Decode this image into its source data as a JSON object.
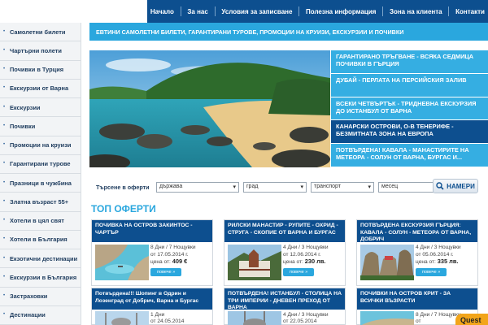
{
  "top_nav": {
    "items": [
      {
        "label": "Начало"
      },
      {
        "label": "За нас"
      },
      {
        "label": "Условия за записване"
      },
      {
        "label": "Полезна информация"
      },
      {
        "label": "Зона на клиента"
      },
      {
        "label": "Контакти"
      }
    ]
  },
  "sidebar": {
    "items": [
      {
        "label": "Самолетни билети"
      },
      {
        "label": "Чартърни полети"
      },
      {
        "label": "Почивки в Турция"
      },
      {
        "label": "Екскурзии от Варна"
      },
      {
        "label": "Екскурзии"
      },
      {
        "label": "Почивки"
      },
      {
        "label": "Промоции на круизи"
      },
      {
        "label": "Гарантирани турове"
      },
      {
        "label": "Празници в чужбина"
      },
      {
        "label": "Златна възраст 55+"
      },
      {
        "label": "Хотели в цял свят"
      },
      {
        "label": "Хотели в България"
      },
      {
        "label": "Екзотични дестинации"
      },
      {
        "label": "Екскурзии в България"
      },
      {
        "label": "Застраховки"
      },
      {
        "label": "Дестинации"
      }
    ]
  },
  "promo_bar": {
    "text": "ЕВТИНИ САМОЛЕТНИ БИЛЕТИ, ГАРАНТИРАНИ ТУРОВЕ, ПРОМОЦИИ НА КРУИЗИ, ЕКСКУРЗИИ И ПОЧИВКИ"
  },
  "promo_list": {
    "items": [
      {
        "text": "ГАРАНТИРАНО ТРЪГВАНЕ - ВСЯКА СЕДМИЦА ПОЧИВКИ В ГЪРЦИЯ"
      },
      {
        "text": "ДУБАЙ - ПЕРЛАТА НА ПЕРСИЙСКИЯ ЗАЛИВ"
      },
      {
        "text": "ВСЕКИ ЧЕТВЪРТЪК - ТРИДНЕВНА ЕКСКУРЗИЯ ДО ИСТАНБУЛ ОТ ВАРНА"
      },
      {
        "text": "КАНАРСКИ ОСТРОВИ, О-В ТЕНЕРИФЕ - БЕЗМИТНАТА ЗОНА НА ЕВРОПА"
      },
      {
        "text": "ПОТВЪРДЕНА! КАВАЛА - МАНАСТИРИТЕ НА МЕТЕОРА - СОЛУН ОТ ВАРНА, БУРГАС И..."
      }
    ]
  },
  "search": {
    "label": "Търсене в оферти",
    "selects": [
      {
        "value": "държава"
      },
      {
        "value": "град"
      },
      {
        "value": "транспорт"
      },
      {
        "value": "месец"
      }
    ],
    "button_label": "НАМЕРИ"
  },
  "offers": {
    "title": "ТОП ОФЕРТИ",
    "more_label": "повече »",
    "cards": [
      {
        "title": "ПОЧИВКА НА ОСТРОВ ЗАКИНТОС - ЧАРТЪР",
        "duration": "8 Дни / 7 Нощувки",
        "date": "от 17.05.2014 г.",
        "price_label": "цена от:",
        "price": "409 €"
      },
      {
        "title": "РИЛСКИ МАНАСТИР - РУПИТЕ - ОХРИД - СТРУГА - СКОПИЕ ОТ ВАРНА И БУРГАС",
        "duration": "4 Дни / 3 Нощувки",
        "date": "от 12.06.2014 г.",
        "price_label": "цена от:",
        "price": "230 лв."
      },
      {
        "title": "ПОТВЪРДЕНА ЕКСКУРЗИЯ ГЪРЦИЯ: КАВАЛА - СОЛУН - МЕТЕОРА ОТ ВАРНА, ДОБРИЧ",
        "duration": "4 Дни / 3 Нощувки",
        "date": "от 05.06.2014 г.",
        "price_label": "цена от:",
        "price": "335 лв."
      },
      {
        "title": "Потвърдена!!! Шопинг в Одрин и Лозенград от Добрич, Варна и Бургас",
        "duration": "1 Дни",
        "date": "от 24.05.2014"
      },
      {
        "title": "ПОТВЪРДЕНА! ИСТАНБУЛ - СТОЛИЦА НА ТРИ ИМПЕРИИ - ДНЕВЕН ПРЕХОД ОТ ВАРНА",
        "duration": "4 Дни / 3 Нощувки",
        "date": "от 22.05.2014"
      },
      {
        "title": "ПОЧИВКИ НА ОСТРОВ КРИТ - ЗА ВСИЧКИ ВЪЗРАСТИ",
        "duration": "8 Дни / 7 Нощувки",
        "date": "от"
      }
    ]
  },
  "chat": {
    "label": "Quest"
  },
  "colors": {
    "nav_blue": "#0d4f8f",
    "accent_blue": "#2aa7de",
    "chat_orange": "#f2a51a"
  }
}
